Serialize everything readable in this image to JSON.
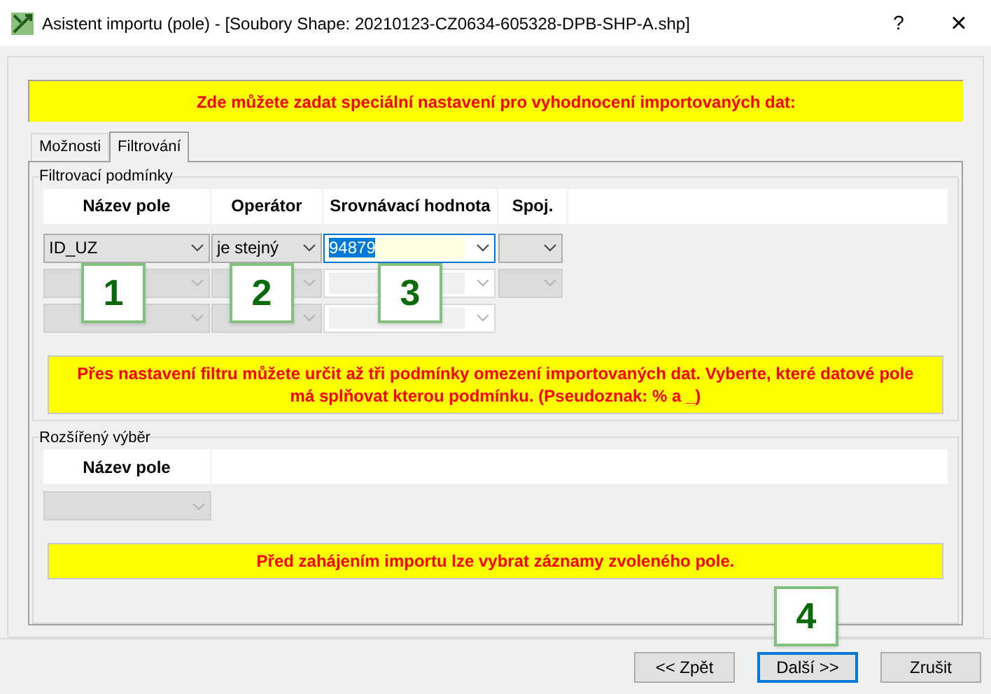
{
  "window": {
    "title": "Asistent importu (pole) - [Soubory Shape: 20210123-CZ0634-605328-DPB-SHP-A.shp]",
    "help": "?",
    "close": "×"
  },
  "banner": "Zde můžete zadat speciální nastavení pro vyhodnocení importovaných dat:",
  "tabs": [
    {
      "label": "Možnosti",
      "selected": false
    },
    {
      "label": "Filtrování",
      "selected": true
    }
  ],
  "filter_group": {
    "title": "Filtrovací podmínky",
    "columns": [
      "Název pole",
      "Operátor",
      "Srovnávací hodnota",
      "Spoj."
    ],
    "rows": [
      {
        "field": {
          "value": "ID_UZ",
          "disabled": false
        },
        "operator": {
          "value": "je stejný",
          "disabled": false
        },
        "compare": {
          "value": "94879",
          "disabled": false,
          "focused": true
        },
        "join": {
          "disabled": false
        }
      },
      {
        "field": {
          "disabled": true
        },
        "operator": {
          "disabled": true
        },
        "compare": {
          "disabled": true,
          "focused": false
        },
        "join": {
          "disabled": true
        }
      },
      {
        "field": {
          "disabled": true
        },
        "operator": {
          "disabled": true
        },
        "compare": {
          "disabled": true,
          "focused": false
        }
      }
    ],
    "note": "Přes nastavení filtru můžete určit až tři podmínky omezení importovaných dat. Vyberte, které datové pole má splňovat kterou podmínku. (Pseudoznak: % a _)"
  },
  "extended_group": {
    "title": "Rozšířený výběr",
    "columns": [
      "Název pole"
    ],
    "field": {
      "disabled": true
    },
    "note": "Před zahájením importu lze vybrat záznamy zvoleného pole."
  },
  "buttons": [
    {
      "label": "<< Zpět",
      "focused": false
    },
    {
      "label": "Další >>",
      "focused": true
    },
    {
      "label": "Zrušit",
      "focused": false
    }
  ],
  "callouts": [
    {
      "label": "1"
    },
    {
      "label": "2"
    },
    {
      "label": "3"
    },
    {
      "label": "4"
    }
  ]
}
